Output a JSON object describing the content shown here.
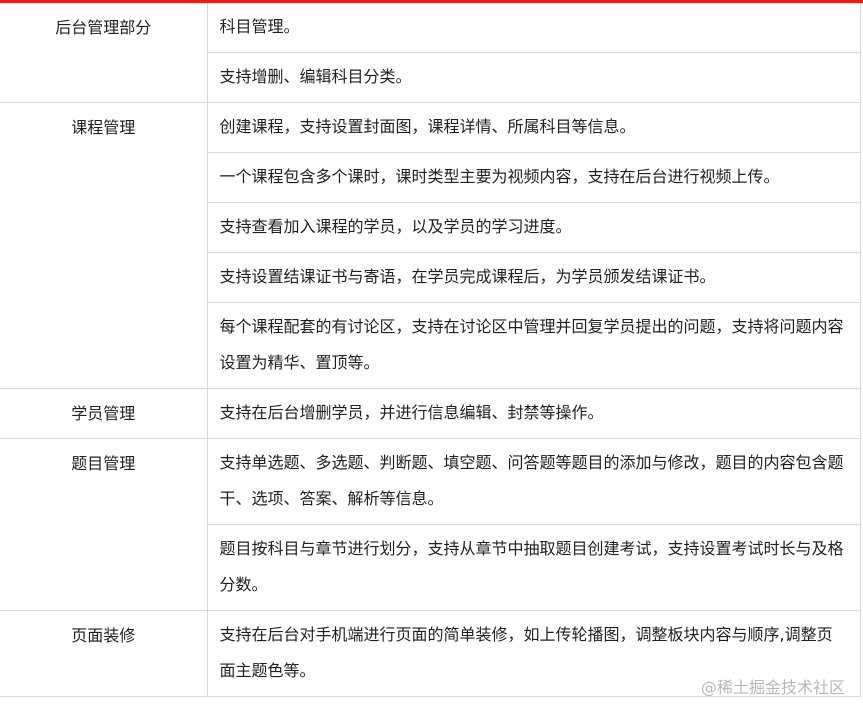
{
  "rows": [
    {
      "category": "后台管理部分",
      "items": [
        "科目管理。",
        "支持增删、编辑科目分类。"
      ]
    },
    {
      "category": "课程管理",
      "items": [
        "创建课程，支持设置封面图，课程详情、所属科目等信息。",
        "一个课程包含多个课时，课时类型主要为视频内容，支持在后台进行视频上传。",
        "支持查看加入课程的学员，以及学员的学习进度。",
        "支持设置结课证书与寄语，在学员完成课程后，为学员颁发结课证书。",
        "每个课程配套的有讨论区，支持在讨论区中管理并回复学员提出的问题，支持将问题内容设置为精华、置顶等。"
      ]
    },
    {
      "category": "学员管理",
      "items": [
        "支持在后台增删学员，并进行信息编辑、封禁等操作。"
      ]
    },
    {
      "category": "题目管理",
      "items": [
        "支持单选题、多选题、判断题、填空题、问答题等题目的添加与修改，题目的内容包含题干、选项、答案、解析等信息。",
        "题目按科目与章节进行划分，支持从章节中抽取题目创建考试，支持设置考试时长与及格分数。"
      ]
    },
    {
      "category": "页面装修",
      "items": [
        "支持在后台对手机端进行页面的简单装修，如上传轮播图，调整板块内容与顺序,调整页面主题色等。"
      ]
    }
  ],
  "watermark": "@稀土掘金技术社区",
  "colors": {
    "accent": "#e02020",
    "border": "#d9d9d9",
    "text": "#1f1f1f",
    "watermark": "#b8b8b8"
  }
}
